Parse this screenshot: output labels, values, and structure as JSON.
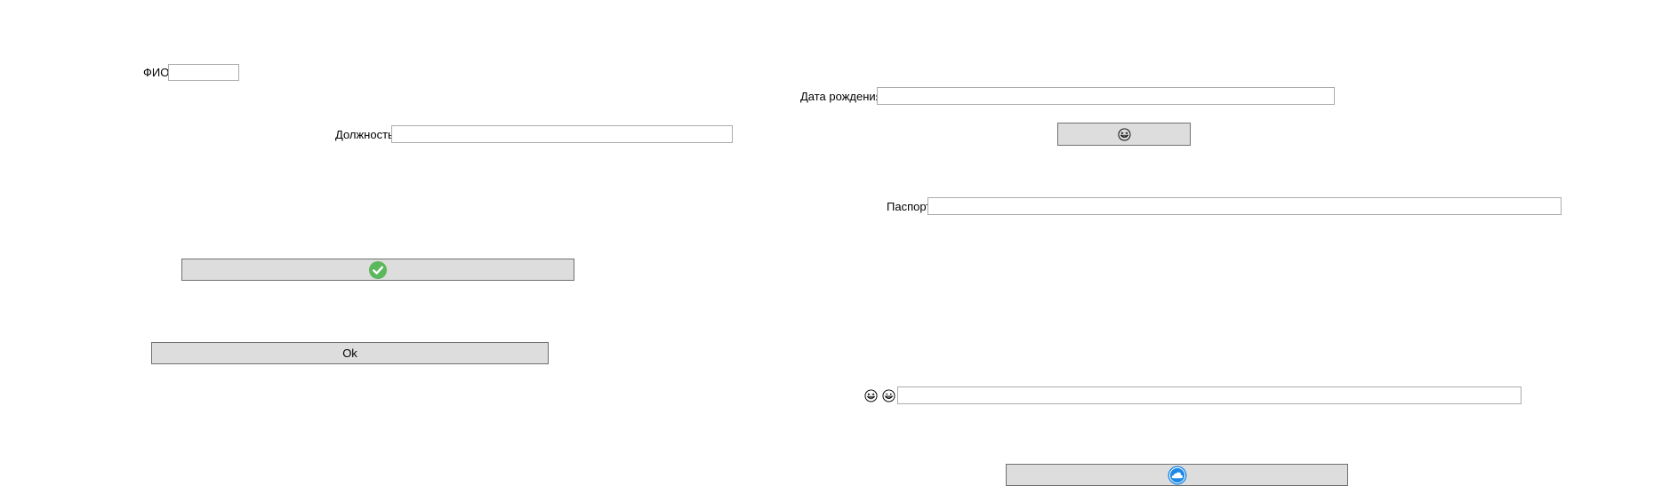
{
  "form": {
    "fio_label": "ФИО",
    "fio_value": "",
    "position_label": "Должность",
    "position_value": "",
    "birthdate_label": "Дата рождения",
    "birthdate_value": "",
    "passport_label": "Паспорт",
    "passport_value": "",
    "emoji_field_value": ""
  },
  "buttons": {
    "ok_label": "Ok",
    "check_icon": "check-circle-icon",
    "laugh_icon": "grinning-squint-face-icon",
    "cloud_icon": "cloud-circle-icon"
  },
  "colors": {
    "button_bg": "#dddddd",
    "button_border": "#707070",
    "input_border": "#ababab",
    "check_green": "#5cb85c",
    "cloud_blue": "#1e88e5"
  }
}
